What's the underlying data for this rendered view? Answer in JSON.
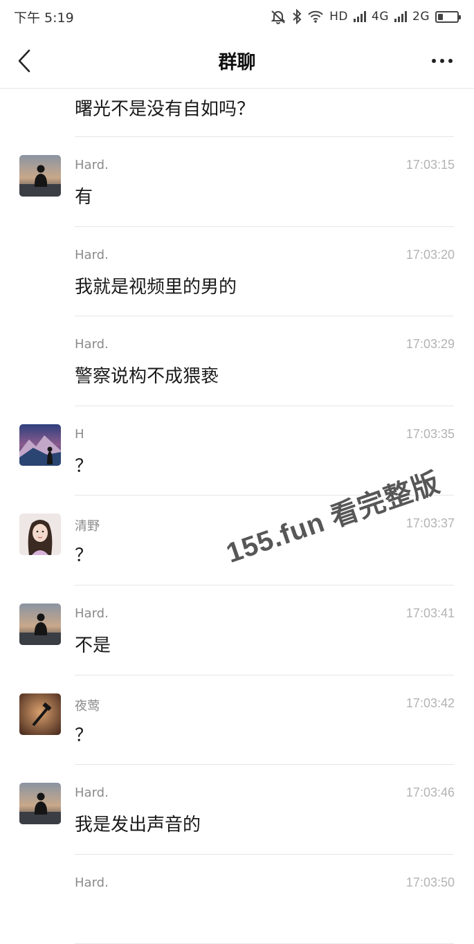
{
  "status_bar": {
    "time": "下午 5:19",
    "indicators": [
      "bell-off-icon",
      "bluetooth-icon",
      "wifi-icon"
    ],
    "hd": "HD",
    "net1": "4G",
    "net2": "2G",
    "battery_level": 0.25
  },
  "nav": {
    "title": "群聊",
    "back_icon": "chevron-left-icon",
    "more_icon": "more-dots-icon"
  },
  "first_message": "曙光不是没有自如吗？",
  "messages": [
    {
      "sender": "Hard.",
      "time": "17:03:15",
      "text": "有",
      "show_avatar": true,
      "avatar": "hard"
    },
    {
      "sender": "Hard.",
      "time": "17:03:20",
      "text": "我就是视频里的男的",
      "show_avatar": false,
      "avatar": "hard"
    },
    {
      "sender": "Hard.",
      "time": "17:03:29",
      "text": "警察说构不成猥亵",
      "show_avatar": false,
      "avatar": "hard"
    },
    {
      "sender": "H",
      "time": "17:03:35",
      "text": "？",
      "show_avatar": true,
      "avatar": "mountain"
    },
    {
      "sender": "清野",
      "time": "17:03:37",
      "text": "？",
      "show_avatar": true,
      "avatar": "girl"
    },
    {
      "sender": "Hard.",
      "time": "17:03:41",
      "text": "不是",
      "show_avatar": true,
      "avatar": "hard"
    },
    {
      "sender": "夜莺",
      "time": "17:03:42",
      "text": "？",
      "show_avatar": true,
      "avatar": "sickle"
    },
    {
      "sender": "Hard.",
      "time": "17:03:46",
      "text": "我是发出声音的",
      "show_avatar": true,
      "avatar": "hard"
    },
    {
      "sender": "Hard.",
      "time": "17:03:50",
      "text": "",
      "show_avatar": false,
      "avatar": "hard"
    }
  ],
  "watermark": "155.fun 看完整版",
  "colors": {
    "divider": "#e6e6e6",
    "sender": "#8a8a8a",
    "time": "#b3b3b3",
    "text": "#1a1a1a"
  }
}
